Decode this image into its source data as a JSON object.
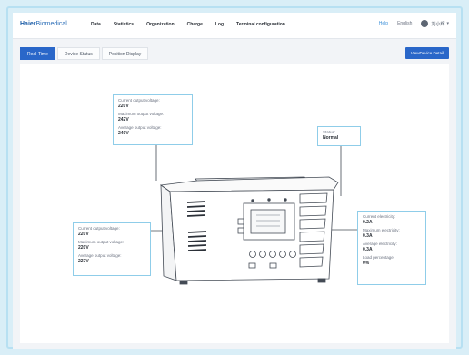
{
  "header": {
    "logo_bold": "Haier",
    "logo_light": "Biomedical",
    "nav": [
      "Data",
      "Statistics",
      "Organization",
      "Charge",
      "Log",
      "Terminal configuration"
    ],
    "help": "Help",
    "language": "English",
    "user": "刘小辉"
  },
  "tabs": [
    "Real-Time",
    "Device Status",
    "Position Display"
  ],
  "detail_button": "ViewDevice Detail",
  "panels": {
    "top_voltage": [
      {
        "label": "Current output voltage:",
        "value": "220V"
      },
      {
        "label": "Maximum output voltage:",
        "value": "242V"
      },
      {
        "label": "Average output voltage:",
        "value": "240V"
      }
    ],
    "status": [
      {
        "label": "Status:",
        "value": "Normal"
      }
    ],
    "left_voltage": [
      {
        "label": "Current output voltage:",
        "value": "220V"
      },
      {
        "label": "Maximum output voltage:",
        "value": "220V"
      },
      {
        "label": "Average output voltage:",
        "value": "227V"
      }
    ],
    "electricity": [
      {
        "label": "Current electricity:",
        "value": "0.2A"
      },
      {
        "label": "Maximum electricity:",
        "value": "0.3A"
      },
      {
        "label": "Average electricity:",
        "value": "0.3A"
      },
      {
        "label": "Load percentage:",
        "value": "0%"
      }
    ]
  },
  "colors": {
    "accent": "#2a67c9",
    "panel_border": "#8fcde9",
    "page_bg": "#d9eef7"
  }
}
